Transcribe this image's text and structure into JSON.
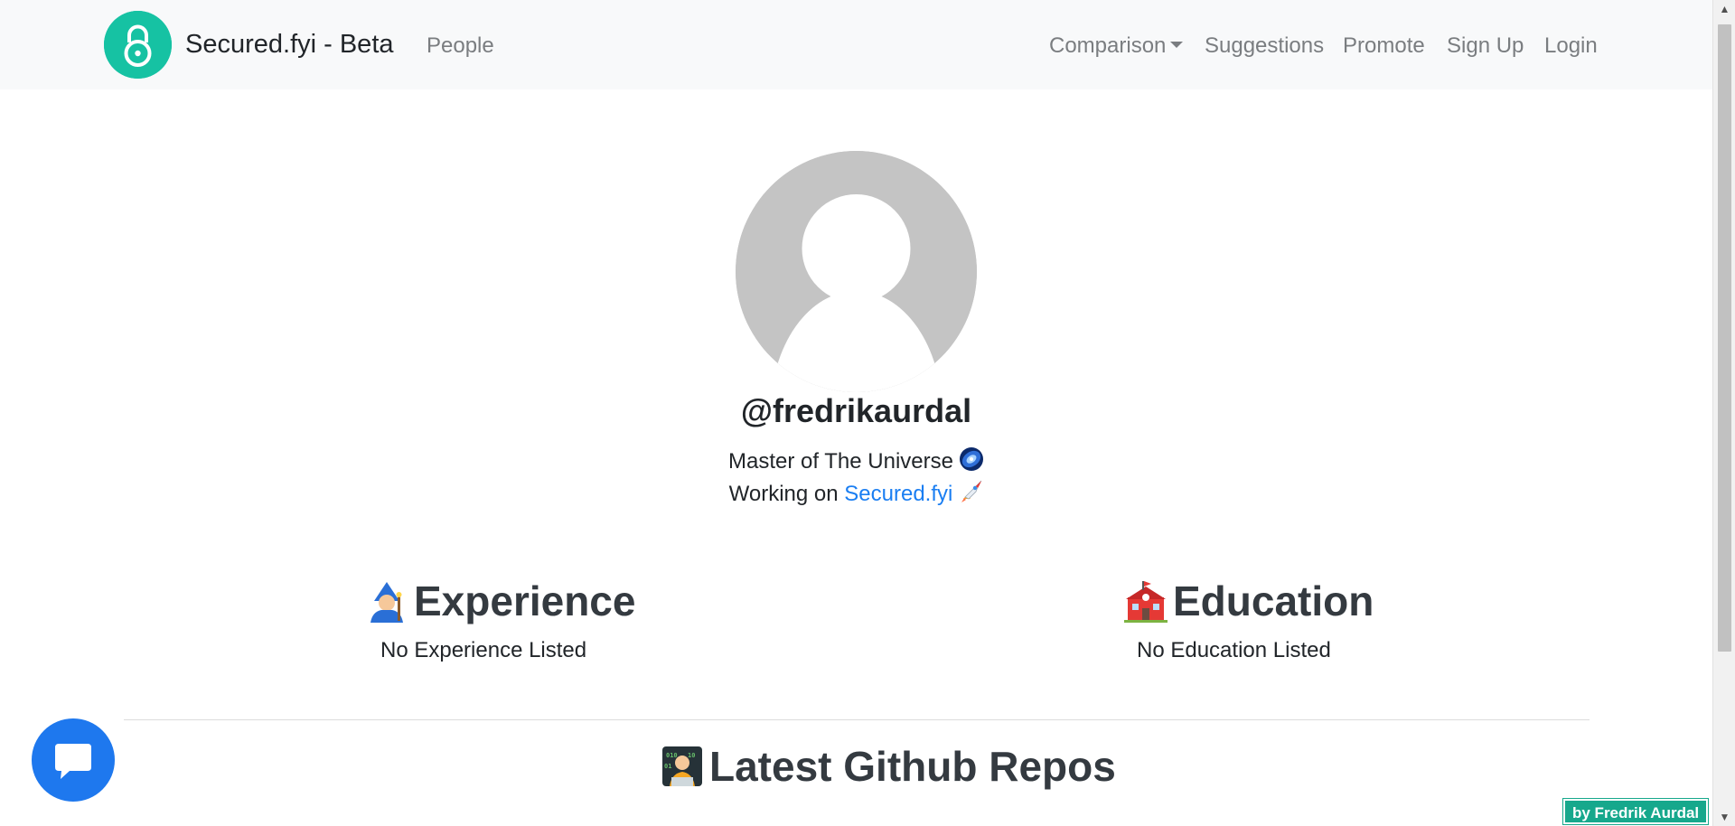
{
  "navbar": {
    "brand": "Secured.fyi - Beta",
    "links": {
      "people": "People",
      "comparison": "Comparison",
      "suggestions": "Suggestions",
      "promote": "Promote",
      "signup": "Sign Up",
      "login": "Login"
    }
  },
  "profile": {
    "username": "@fredrikaurdal",
    "bio_line1": "Master of The Universe",
    "bio_line2_prefix": "Working on",
    "bio_line2_link": "Secured.fyi"
  },
  "sections": {
    "experience": {
      "title": "Experience",
      "empty": "No Experience Listed"
    },
    "education": {
      "title": "Education",
      "empty": "No Education Listed"
    },
    "github": {
      "title": "Latest Github Repos"
    }
  },
  "badge": {
    "text": "by Fredrik Aurdal"
  },
  "icons": {
    "brand": "lock-icon",
    "chat": "chat-bubble-icon",
    "experience": "mage-emoji-icon",
    "education": "school-emoji-icon",
    "github": "technologist-emoji-icon",
    "bio1": "galaxy-emoji-icon",
    "bio2": "rocket-emoji-icon"
  },
  "colors": {
    "brand_teal": "#16c2a3",
    "link_blue": "#1a7ef2",
    "chat_blue": "#1e78ee",
    "badge_green": "#16a88c",
    "navbar_bg": "#f8f9fa",
    "nav_text": "#7a7d80"
  }
}
